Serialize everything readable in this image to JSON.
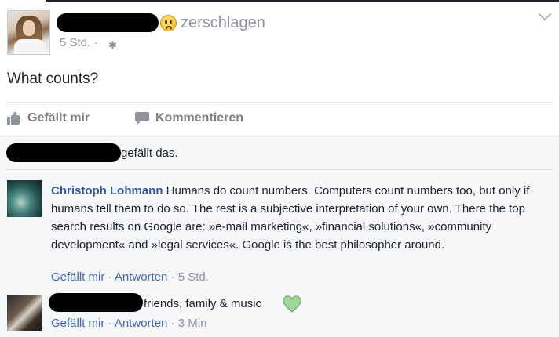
{
  "post": {
    "feeling": "zerschlagen",
    "timestamp": "5 Std. ·",
    "text": "What counts?"
  },
  "actions": {
    "like_label": "Gefällt mir",
    "comment_label": "Kommentieren"
  },
  "likes": {
    "text": "gefällt das."
  },
  "comments": [
    {
      "author": "Christoph Lohmann",
      "text": " Humans do count numbers. Computers count numbers too, but only if humans tell them to do so. The rest is a subjective interpretation of your own. There the top search results on Google are: »e-mail marketing«, »financial solutions«, »community development« and »legal services«. Google is the best philosopher around.",
      "like_label": "Gefällt mir",
      "sep1": " · ",
      "reply_label": "Antworten",
      "sep2": " · ",
      "time": "5 Std."
    },
    {
      "text": "friends, family & music",
      "like_label": "Gefällt mir",
      "sep1": " · ",
      "reply_label": "Antworten",
      "sep2": " · ",
      "time": "3 Min"
    }
  ],
  "colors": {
    "link": "#365899",
    "meta_link": "#4267b2",
    "meta_gray": "#90949c",
    "comments_bg": "#f6f7f9",
    "heart": "#a3d69a"
  }
}
